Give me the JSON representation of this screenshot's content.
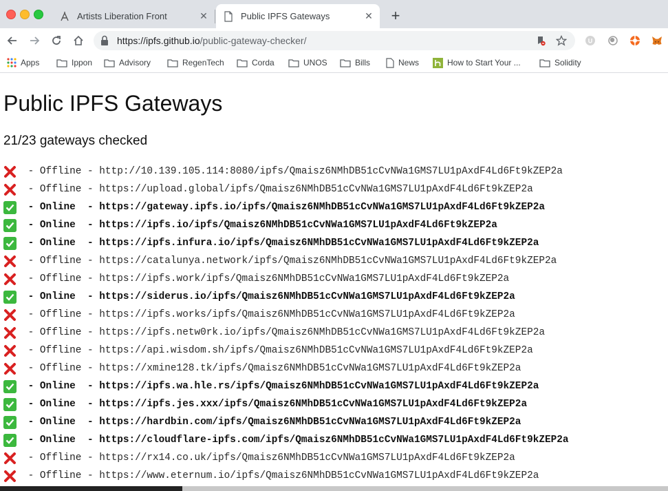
{
  "window": {
    "tabs": [
      {
        "title": "Artists Liberation Front",
        "active": false,
        "icon": "artist-favicon"
      },
      {
        "title": "Public IPFS Gateways",
        "active": true,
        "icon": "document-icon"
      }
    ],
    "new_tab_label": "+"
  },
  "toolbar": {
    "url_host": "https://ipfs.github.io",
    "url_path": "/public-gateway-checker/"
  },
  "bookmarks": [
    {
      "label": "Apps",
      "icon": "apps-grid-icon"
    },
    {
      "label": "Ippon",
      "icon": "folder-icon"
    },
    {
      "label": "Advisory",
      "icon": "folder-icon"
    },
    {
      "label": "RegenTech",
      "icon": "folder-icon"
    },
    {
      "label": "Corda",
      "icon": "folder-icon"
    },
    {
      "label": "UNOS",
      "icon": "folder-icon"
    },
    {
      "label": "Bills",
      "icon": "folder-icon"
    },
    {
      "label": "News",
      "icon": "page-icon"
    },
    {
      "label": "How to Start Your ...",
      "icon": "green-h-icon"
    },
    {
      "label": "Solidity",
      "icon": "folder-icon"
    }
  ],
  "page": {
    "title": "Public IPFS Gateways",
    "checked_status": "21/23 gateways checked",
    "separator": " - ",
    "gateways": [
      {
        "status": "Offline",
        "url": "http://10.139.105.114:8080/ipfs/Qmaisz6NMhDB51cCvNWa1GMS7LU1pAxdF4Ld6Ft9kZEP2a"
      },
      {
        "status": "Offline",
        "url": "https://upload.global/ipfs/Qmaisz6NMhDB51cCvNWa1GMS7LU1pAxdF4Ld6Ft9kZEP2a"
      },
      {
        "status": "Online ",
        "url": "https://gateway.ipfs.io/ipfs/Qmaisz6NMhDB51cCvNWa1GMS7LU1pAxdF4Ld6Ft9kZEP2a"
      },
      {
        "status": "Online ",
        "url": "https://ipfs.io/ipfs/Qmaisz6NMhDB51cCvNWa1GMS7LU1pAxdF4Ld6Ft9kZEP2a"
      },
      {
        "status": "Online ",
        "url": "https://ipfs.infura.io/ipfs/Qmaisz6NMhDB51cCvNWa1GMS7LU1pAxdF4Ld6Ft9kZEP2a"
      },
      {
        "status": "Offline",
        "url": "https://catalunya.network/ipfs/Qmaisz6NMhDB51cCvNWa1GMS7LU1pAxdF4Ld6Ft9kZEP2a"
      },
      {
        "status": "Offline",
        "url": "https://ipfs.work/ipfs/Qmaisz6NMhDB51cCvNWa1GMS7LU1pAxdF4Ld6Ft9kZEP2a"
      },
      {
        "status": "Online ",
        "url": "https://siderus.io/ipfs/Qmaisz6NMhDB51cCvNWa1GMS7LU1pAxdF4Ld6Ft9kZEP2a"
      },
      {
        "status": "Offline",
        "url": "https://ipfs.works/ipfs/Qmaisz6NMhDB51cCvNWa1GMS7LU1pAxdF4Ld6Ft9kZEP2a"
      },
      {
        "status": "Offline",
        "url": "https://ipfs.netw0rk.io/ipfs/Qmaisz6NMhDB51cCvNWa1GMS7LU1pAxdF4Ld6Ft9kZEP2a"
      },
      {
        "status": "Offline",
        "url": "https://api.wisdom.sh/ipfs/Qmaisz6NMhDB51cCvNWa1GMS7LU1pAxdF4Ld6Ft9kZEP2a"
      },
      {
        "status": "Offline",
        "url": "https://xmine128.tk/ipfs/Qmaisz6NMhDB51cCvNWa1GMS7LU1pAxdF4Ld6Ft9kZEP2a"
      },
      {
        "status": "Online ",
        "url": "https://ipfs.wa.hle.rs/ipfs/Qmaisz6NMhDB51cCvNWa1GMS7LU1pAxdF4Ld6Ft9kZEP2a"
      },
      {
        "status": "Online ",
        "url": "https://ipfs.jes.xxx/ipfs/Qmaisz6NMhDB51cCvNWa1GMS7LU1pAxdF4Ld6Ft9kZEP2a"
      },
      {
        "status": "Online ",
        "url": "https://hardbin.com/ipfs/Qmaisz6NMhDB51cCvNWa1GMS7LU1pAxdF4Ld6Ft9kZEP2a"
      },
      {
        "status": "Online ",
        "url": "https://cloudflare-ipfs.com/ipfs/Qmaisz6NMhDB51cCvNWa1GMS7LU1pAxdF4Ld6Ft9kZEP2a"
      },
      {
        "status": "Offline",
        "url": "https://rx14.co.uk/ipfs/Qmaisz6NMhDB51cCvNWa1GMS7LU1pAxdF4Ld6Ft9kZEP2a"
      },
      {
        "status": "Offline",
        "url": "https://www.eternum.io/ipfs/Qmaisz6NMhDB51cCvNWa1GMS7LU1pAxdF4Ld6Ft9kZEP2a"
      }
    ]
  },
  "colors": {
    "online_icon": "#3cb83e",
    "offline_icon": "#d92121",
    "tabstrip": "#dee1e6"
  }
}
